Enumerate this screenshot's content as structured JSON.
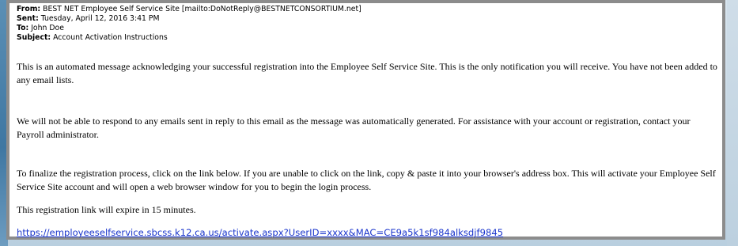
{
  "email": {
    "header": {
      "from_label": "From:",
      "from_value": "BEST NET Employee Self Service Site [mailto:DoNotReply@BESTNETCONSORTIUM.net]",
      "sent_label": "Sent:",
      "sent_value": "Tuesday, April 12, 2016 3:41 PM",
      "to_label": "To:",
      "to_value": "John Doe",
      "subject_label": "Subject:",
      "subject_value": "Account Activation Instructions"
    },
    "body": {
      "paragraph_1": "This is an automated message acknowledging your successful registration into the Employee Self Service Site. This is the only notification you will receive. You have not been added to any email lists.",
      "paragraph_2": "We will not be able to respond to any emails sent in reply to this email as the message was automatically generated. For assistance with your account or registration, contact your Payroll administrator.",
      "paragraph_3": "To finalize the registration process, click on the link below. If you are unable to click on the link, copy & paste it into your browser's address box. This will activate your Employee Self Service Site account and will open a web browser window for you to begin the login process.",
      "paragraph_4": "This registration link will expire in 15 minutes.",
      "activation_link": "https://employeeselfservice.sbcss.k12.ca.us/activate.aspx?UserID=xxxx&MAC=CE9a5k1sf984alksdjf9845"
    }
  },
  "colors": {
    "link": "#1a35cc",
    "frame_border": "#8c8c8c",
    "background_accent": "#3f77a2"
  }
}
